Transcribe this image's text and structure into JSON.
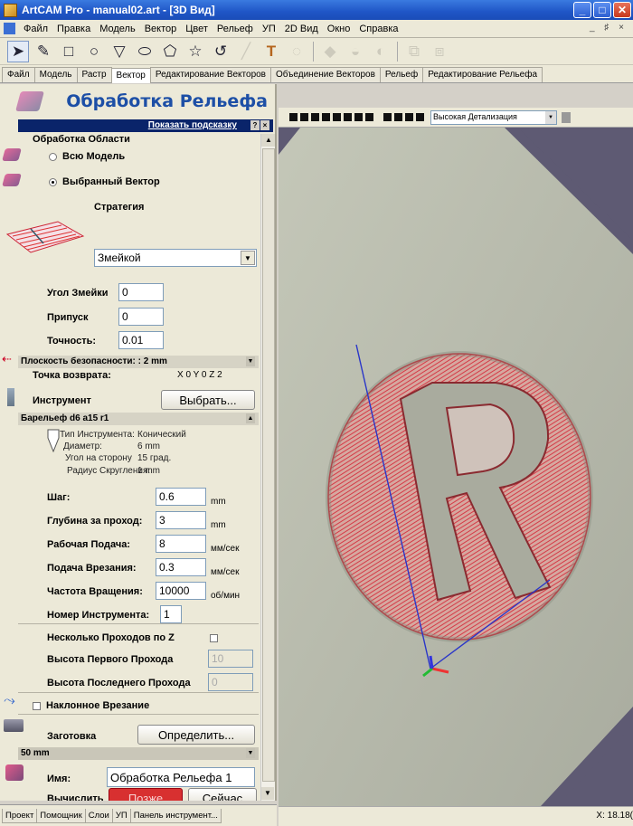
{
  "window": {
    "title": "ArtCAM Pro - manual02.art - [3D Вид]"
  },
  "menu": [
    "Файл",
    "Правка",
    "Модель",
    "Вектор",
    "Цвет",
    "Рельеф",
    "УП",
    "2D Вид",
    "Окно",
    "Справка"
  ],
  "mdi_controls": "_ ♯ ×",
  "tabs": [
    "Файл",
    "Модель",
    "Растр",
    "Вектор",
    "Редактирование Векторов",
    "Объединение Векторов",
    "Рельеф",
    "Редактирование Рельефа"
  ],
  "active_tab": "Вектор",
  "panel": {
    "title": "Обработка Рельефа",
    "hint": "Показать подсказку",
    "area_label": "Обработка Области",
    "opt_model": "Всю Модель",
    "opt_vector": "Выбранный Вектор",
    "strategy_label": "Стратегия",
    "strategy_value": "Змейкой",
    "angle_label": "Угол Змейки",
    "angle_value": "0",
    "allowance_label": "Припуск",
    "allowance_value": "0",
    "tolerance_label": "Точность:",
    "tolerance_value": "0.01",
    "safe_plane": "Плоскость безопасности: : 2 mm",
    "home_label": "Точка возврата:",
    "home_value": "X 0 Y 0 Z 2",
    "tool_label": "Инструмент",
    "tool_btn": "Выбрать...",
    "tool_name": "Барельеф d6 a15 r1",
    "tool_info": [
      {
        "k": "Тип Инструмента:",
        "v": "Конический"
      },
      {
        "k": "Диаметр:",
        "v": "6 mm"
      },
      {
        "k": "Угол на сторону",
        "v": "15 град."
      },
      {
        "k": "Радиус Скругления:",
        "v": "1 mm"
      }
    ],
    "params": [
      {
        "label": "Шаг:",
        "value": "0.6",
        "unit": "mm"
      },
      {
        "label": "Глубина за проход:",
        "value": "3",
        "unit": "mm"
      },
      {
        "label": "Рабочая Подача:",
        "value": "8",
        "unit": "мм/сек"
      },
      {
        "label": "Подача Врезания:",
        "value": "0.3",
        "unit": "мм/сек"
      },
      {
        "label": "Частота Вращения:",
        "value": "10000",
        "unit": "об/мин"
      },
      {
        "label": "Номер Инструмента:",
        "value": "1",
        "unit": ""
      }
    ],
    "multi_z": "Несколько Проходов по Z",
    "first_pass": "Высота Первого Прохода",
    "first_pass_value": "10",
    "last_pass": "Высота Последнего Прохода",
    "last_pass_value": "0",
    "ramp": "Наклонное Врезание",
    "stock_label": "Заготовка",
    "stock_btn": "Определить...",
    "stock_value": "50 mm",
    "name_label": "Имя:",
    "name_value": "Обработка Рельефа 1",
    "compute_label": "Вычислить",
    "later_btn": "Позже",
    "now_btn": "Сейчас"
  },
  "bottom_tabs": [
    "Проект",
    "Помощник",
    "Слои",
    "УП",
    "Панель инструмент..."
  ],
  "view": {
    "detail": "Высокая Детализация",
    "coord": "X: 18.18("
  },
  "colors": {
    "toolpath": "#e0303a",
    "accent": "#1d4fa6",
    "hint": "#0a246a"
  }
}
